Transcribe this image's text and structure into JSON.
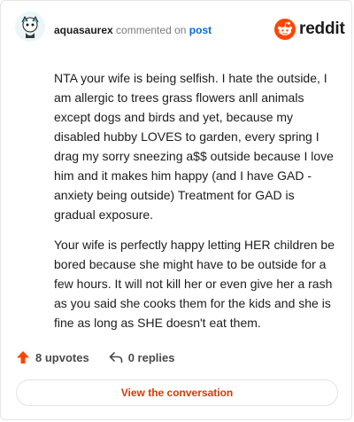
{
  "comment": {
    "username": "aquasaurex",
    "commented_on": "commented on",
    "post_link": "post",
    "paragraphs": [
      "NTA your wife is being selfish. I hate the outside, I am allergic to trees grass flowers anll animals except dogs and birds and yet, because my disabled hubby LOVES to garden, every spring I drag my sorry sneezing a$$ outside because I love him and it makes him happy (and I have GAD - anxiety being outside) Treatment for GAD is gradual exposure.",
      "Your wife is perfectly happy letting HER children be bored because she might have to be outside for a few hours. It will not kill her or even give her a rash as you said she cooks them for the kids and she is fine as long as SHE doesn't eat them."
    ]
  },
  "brand": {
    "name": "reddit",
    "color": "#ff4500",
    "icon": "reddit-snoo-icon"
  },
  "actions": {
    "upvotes": "8 upvotes",
    "replies": "0 replies",
    "upvote_color": "#ff4500"
  },
  "view_button": {
    "label": "View the conversation",
    "color": "#d93a00"
  }
}
